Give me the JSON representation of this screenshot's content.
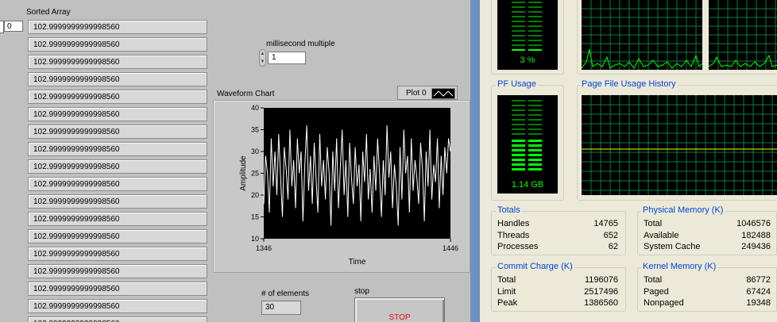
{
  "labview": {
    "sorted_array_label": "Sorted Array",
    "index_value": "0",
    "array_values": [
      "102.9999999999998560",
      "102.9999999999998560",
      "102.9999999999998560",
      "102.9999999999998560",
      "102.9999999999998560",
      "102.9999999999998560",
      "102.9999999999998560",
      "102.9999999999998560",
      "102.9999999999998560",
      "102.9999999999998560",
      "102.9999999999998560",
      "102.9999999999998560",
      "102.9999999999998560",
      "102.9999999999998560",
      "102.9999999999998560",
      "102.9999999999998560",
      "102.9999999999998560",
      "102.9999999999998560"
    ],
    "ms_multiple_label": "millisecond multiple",
    "ms_multiple_value": "1",
    "chart_label": "Waveform Chart",
    "plot_legend": "Plot 0",
    "elements_label": "# of elements",
    "elements_value": "30",
    "stop_label": "stop",
    "stop_button": "STOP"
  },
  "chart_data": {
    "type": "line",
    "title": "Waveform Chart",
    "xlabel": "Time",
    "ylabel": "Amplitude",
    "xlim": [
      1346,
      1446
    ],
    "ylim": [
      10,
      40
    ],
    "x_ticks": [
      "1346",
      "1446"
    ],
    "y_ticks": [
      "40",
      "35",
      "30",
      "25",
      "20",
      "15",
      "10"
    ],
    "grid": false,
    "line_color": "#ffffff",
    "background": "#000000",
    "series": [
      {
        "name": "Plot 0",
        "values": [
          18,
          29,
          25,
          16,
          33,
          22,
          30,
          20,
          34,
          24,
          15,
          31,
          26,
          19,
          35,
          22,
          28,
          17,
          33,
          25,
          30,
          14,
          27,
          36,
          21,
          29,
          18,
          32,
          24,
          16,
          34,
          22,
          28,
          19,
          31,
          25,
          13,
          30,
          21,
          33,
          17,
          26,
          35,
          20,
          28,
          15,
          32,
          24,
          18,
          31,
          22,
          27,
          14,
          30,
          23,
          34,
          19,
          26,
          16,
          29,
          21,
          33,
          25,
          15,
          28,
          20,
          36,
          24,
          30,
          17,
          27,
          22,
          13,
          31,
          19,
          35,
          25,
          29,
          16,
          33,
          21,
          28,
          24,
          18,
          32,
          26,
          14,
          30,
          22,
          35,
          19,
          27,
          23,
          33,
          17,
          29,
          20,
          31,
          25,
          33,
          30
        ]
      }
    ]
  },
  "taskmanager": {
    "cpu_usage_text": "3 %",
    "pf_usage_title": "PF Usage",
    "pf_usage_text": "1.14 GB",
    "pf_history_title": "Page File Usage History",
    "totals": {
      "title": "Totals",
      "rows": [
        {
          "label": "Handles",
          "value": "14765"
        },
        {
          "label": "Threads",
          "value": "652"
        },
        {
          "label": "Processes",
          "value": "62"
        }
      ]
    },
    "physical": {
      "title": "Physical Memory (K)",
      "rows": [
        {
          "label": "Total",
          "value": "1046576"
        },
        {
          "label": "Available",
          "value": "182488"
        },
        {
          "label": "System Cache",
          "value": "249436"
        }
      ]
    },
    "commit": {
      "title": "Commit Charge (K)",
      "rows": [
        {
          "label": "Total",
          "value": "1196076"
        },
        {
          "label": "Limit",
          "value": "2517496"
        },
        {
          "label": "Peak",
          "value": "1386560"
        }
      ]
    },
    "kernel": {
      "title": "Kernel Memory (K)",
      "rows": [
        {
          "label": "Total",
          "value": "86772"
        },
        {
          "label": "Paged",
          "value": "67424"
        },
        {
          "label": "Nonpaged",
          "value": "19348"
        }
      ]
    }
  }
}
